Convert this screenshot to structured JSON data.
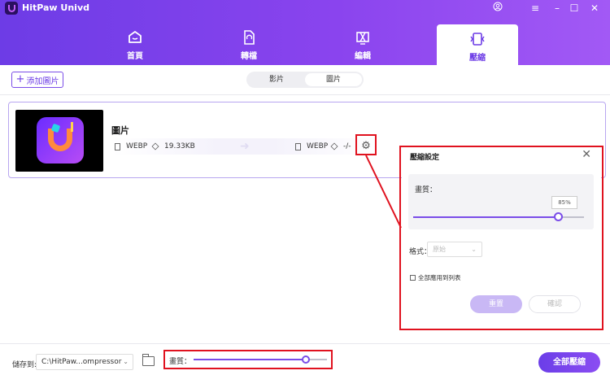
{
  "app": {
    "title": "HitPaw Univd"
  },
  "nav": {
    "tabs": [
      {
        "label": "首頁"
      },
      {
        "label": "轉檔"
      },
      {
        "label": "編輯"
      },
      {
        "label": "壓縮"
      }
    ],
    "active": "壓縮"
  },
  "toolbar": {
    "add_label": "添加圖片",
    "segments": [
      "影片",
      "圖片"
    ],
    "active_segment": "圖片"
  },
  "file": {
    "name": "圖片",
    "src_format": "WEBP",
    "src_size": "19.33KB",
    "dst_format": "WEBP",
    "dst_size": "-/-"
  },
  "popup": {
    "title": "壓縮設定",
    "quality_label": "畫質：",
    "quality_value": "85%",
    "quality_fraction": 0.85,
    "format_label": "格式：",
    "format_value": "原始",
    "apply_all_label": "全部應用到列表",
    "reset_label": "重置",
    "confirm_label": "確認"
  },
  "bottom": {
    "save_label": "儲存到:",
    "path": "C:\\HitPaw...ompressor",
    "quality_label": "畫質：",
    "quality_fraction": 0.84,
    "compress_all_label": "全部壓縮"
  },
  "colors": {
    "accent": "#7a4ce8",
    "highlight": "#e0121f"
  }
}
